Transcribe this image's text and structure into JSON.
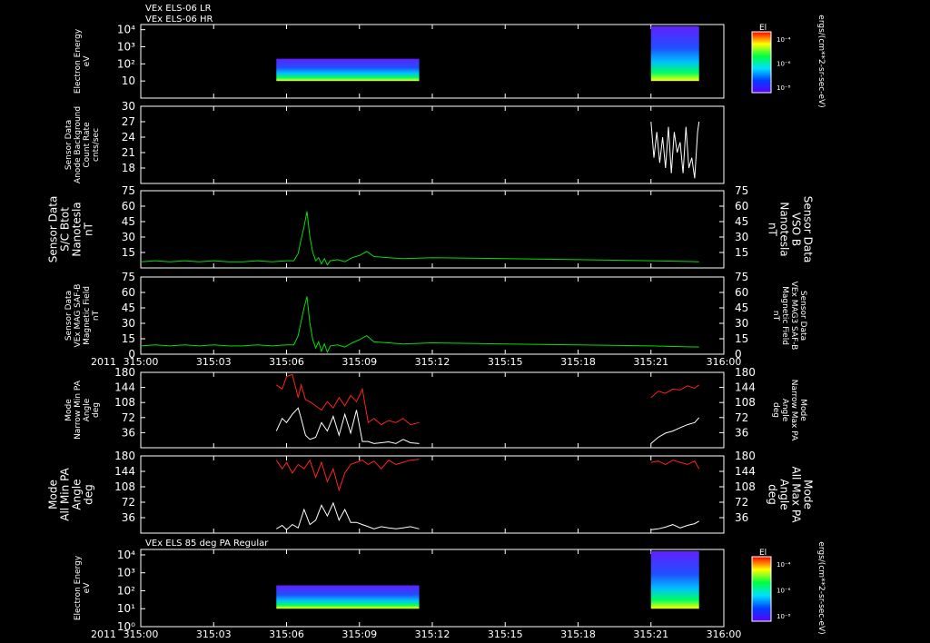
{
  "header": {
    "line1": "VEx ELS-06 LR",
    "line2": "VEx ELS-06 HR"
  },
  "year_label": "2011",
  "time_ticks": [
    "315:00",
    "315:03",
    "315:06",
    "315:09",
    "315:12",
    "315:15",
    "315:18",
    "315:21",
    "316:00"
  ],
  "colors": {
    "white": "#ffffff",
    "green": "#00e000",
    "red": "#ff2020",
    "frame": "#ffffff",
    "bg": "#000000"
  },
  "chart_data": [
    {
      "type": "heatmap",
      "id": "p1",
      "title": "VEx ELS-06 LR / VEx ELS-06 HR",
      "ylabel": [
        "Electron Energy",
        "eV"
      ],
      "log_y": true,
      "ylim": [
        1,
        20000
      ],
      "yticks": [
        "10",
        "10²",
        "10³",
        "10⁴"
      ],
      "yticks_base": [
        1,
        2,
        3,
        4
      ],
      "colorbar": {
        "title": "El",
        "ticks": [
          "10⁻⁴",
          "10⁻⁶",
          "10⁻⁸"
        ]
      },
      "colorbar_label": "ergs/(cm**2-sr-sec-eV)",
      "data_ranges": [
        [
          315.093,
          315.191
        ],
        [
          315.35,
          315.383
        ]
      ]
    },
    {
      "type": "line",
      "id": "p2",
      "ylabel": [
        "Sensor Data",
        "Anode Background",
        "Count Rate",
        "cnts/sec"
      ],
      "ylim": [
        15,
        30
      ],
      "yticks": [
        18,
        21,
        24,
        27,
        30
      ],
      "series": [
        {
          "color": "white",
          "x": [
            315.35,
            315.352,
            315.354,
            315.356,
            315.358,
            315.36,
            315.362,
            315.364,
            315.366,
            315.368,
            315.37,
            315.372,
            315.374,
            315.376,
            315.378,
            315.38,
            315.382,
            315.383
          ],
          "y": [
            27,
            20,
            25,
            19,
            24,
            18,
            26,
            17,
            25,
            21,
            23,
            17,
            26,
            18,
            20,
            16,
            25,
            27
          ]
        }
      ]
    },
    {
      "type": "line",
      "id": "p3",
      "ylabel": [
        "Sensor Data",
        "S/C Btot",
        "Nanotesla",
        "nT"
      ],
      "ylabel_right": [
        "Sensor Data",
        "VSO B",
        "Nanotesla",
        "nT"
      ],
      "ylim": [
        0,
        75
      ],
      "yticks": [
        15,
        30,
        45,
        60,
        75
      ],
      "series": [
        {
          "color": "green",
          "x": [
            315.0,
            315.01,
            315.02,
            315.03,
            315.04,
            315.05,
            315.06,
            315.07,
            315.08,
            315.09,
            315.1,
            315.105,
            315.108,
            315.11,
            315.112,
            315.114,
            315.116,
            315.118,
            315.12,
            315.122,
            315.124,
            315.126,
            315.128,
            315.13,
            315.135,
            315.14,
            315.145,
            315.15,
            315.155,
            315.16,
            315.17,
            315.18,
            315.2,
            315.25,
            315.3,
            315.35,
            315.383
          ],
          "y": [
            6,
            7,
            6,
            7,
            6,
            7,
            6,
            6,
            7,
            6,
            7,
            7,
            14,
            28,
            40,
            55,
            30,
            15,
            7,
            10,
            4,
            9,
            3,
            7,
            8,
            6,
            10,
            12,
            16,
            11,
            10,
            9,
            10,
            9,
            8,
            7,
            6
          ]
        }
      ]
    },
    {
      "type": "line",
      "id": "p4",
      "ylabel": [
        "Sensor Data",
        "VEx MAG SAF-B",
        "Magnetic Field",
        "nT"
      ],
      "ylabel_right": [
        "Sensor Data",
        "VEx MAG3 SAF-B",
        "Magnetic Field",
        "nT"
      ],
      "ylim": [
        0,
        75
      ],
      "yticks": [
        0,
        15,
        30,
        45,
        60,
        75
      ],
      "series": [
        {
          "color": "green",
          "x": [
            315.0,
            315.01,
            315.02,
            315.03,
            315.04,
            315.05,
            315.06,
            315.07,
            315.08,
            315.09,
            315.1,
            315.105,
            315.108,
            315.11,
            315.112,
            315.114,
            315.116,
            315.118,
            315.12,
            315.122,
            315.124,
            315.126,
            315.128,
            315.13,
            315.135,
            315.14,
            315.145,
            315.15,
            315.155,
            315.16,
            315.17,
            315.18,
            315.2,
            315.25,
            315.3,
            315.35,
            315.383
          ],
          "y": [
            8,
            9,
            8,
            9,
            8,
            9,
            8,
            8,
            9,
            8,
            9,
            9,
            18,
            32,
            45,
            56,
            30,
            14,
            6,
            12,
            3,
            10,
            2,
            8,
            9,
            7,
            11,
            14,
            18,
            12,
            11,
            10,
            11,
            10,
            9,
            8,
            7
          ]
        }
      ]
    },
    {
      "type": "line",
      "id": "p5",
      "ylabel": [
        "Mode",
        "Narrow Min PA",
        "Angle",
        "deg"
      ],
      "ylabel_right": [
        "Mode",
        "Narrow Max PA",
        "Angle",
        "deg"
      ],
      "ylim": [
        0,
        180
      ],
      "yticks": [
        36,
        72,
        108,
        144,
        180
      ],
      "series": [
        {
          "color": "white",
          "x": [
            315.093,
            315.097,
            315.1,
            315.104,
            315.108,
            315.11,
            315.113,
            315.116,
            315.12,
            315.124,
            315.128,
            315.132,
            315.136,
            315.14,
            315.144,
            315.148,
            315.152,
            315.156,
            315.16,
            315.165,
            315.17,
            315.175,
            315.18,
            315.185,
            315.191,
            null,
            315.35,
            315.355,
            315.36,
            315.365,
            315.37,
            315.375,
            315.38,
            315.383
          ],
          "y": [
            40,
            70,
            60,
            80,
            95,
            70,
            30,
            20,
            25,
            60,
            40,
            75,
            30,
            80,
            35,
            90,
            15,
            15,
            10,
            12,
            14,
            10,
            20,
            12,
            10,
            null,
            10,
            25,
            35,
            40,
            48,
            55,
            60,
            72
          ]
        },
        {
          "color": "red",
          "x": [
            315.093,
            315.097,
            315.1,
            315.104,
            315.108,
            315.11,
            315.113,
            315.116,
            315.12,
            315.124,
            315.128,
            315.132,
            315.136,
            315.14,
            315.144,
            315.148,
            315.152,
            315.156,
            315.16,
            315.165,
            315.17,
            315.175,
            315.18,
            315.185,
            315.191,
            null,
            315.35,
            315.355,
            315.36,
            315.365,
            315.37,
            315.375,
            315.38,
            315.383
          ],
          "y": [
            150,
            140,
            170,
            175,
            120,
            150,
            115,
            110,
            100,
            90,
            110,
            95,
            120,
            100,
            125,
            110,
            140,
            60,
            70,
            55,
            65,
            60,
            70,
            55,
            60,
            null,
            120,
            135,
            130,
            140,
            138,
            148,
            142,
            150
          ]
        }
      ]
    },
    {
      "type": "line",
      "id": "p6",
      "ylabel": [
        "Mode",
        "All Min PA",
        "Angle",
        "deg"
      ],
      "ylabel_right": [
        "Mode",
        "All Max PA",
        "Angle",
        "deg"
      ],
      "ylim": [
        0,
        180
      ],
      "yticks": [
        36,
        72,
        108,
        144,
        180
      ],
      "series": [
        {
          "color": "white",
          "x": [
            315.093,
            315.097,
            315.1,
            315.104,
            315.108,
            315.112,
            315.116,
            315.12,
            315.124,
            315.128,
            315.132,
            315.136,
            315.14,
            315.144,
            315.148,
            315.152,
            315.156,
            315.16,
            315.165,
            315.17,
            315.175,
            315.18,
            315.185,
            315.191,
            null,
            315.35,
            315.355,
            315.36,
            315.365,
            315.37,
            315.375,
            315.38,
            315.383
          ],
          "y": [
            10,
            18,
            8,
            20,
            12,
            55,
            20,
            30,
            65,
            40,
            70,
            30,
            55,
            25,
            25,
            20,
            15,
            10,
            15,
            12,
            10,
            12,
            15,
            10,
            null,
            8,
            10,
            14,
            20,
            12,
            18,
            22,
            28
          ]
        },
        {
          "color": "red",
          "x": [
            315.093,
            315.097,
            315.1,
            315.104,
            315.108,
            315.112,
            315.116,
            315.12,
            315.124,
            315.128,
            315.132,
            315.136,
            315.14,
            315.144,
            315.148,
            315.152,
            315.156,
            315.16,
            315.165,
            315.17,
            315.175,
            315.18,
            315.185,
            315.191,
            null,
            315.35,
            315.355,
            315.36,
            315.365,
            315.37,
            315.375,
            315.38,
            315.383
          ],
          "y": [
            170,
            150,
            165,
            140,
            160,
            150,
            170,
            130,
            165,
            120,
            150,
            100,
            140,
            160,
            165,
            170,
            160,
            168,
            150,
            170,
            160,
            165,
            170,
            172,
            null,
            165,
            168,
            160,
            170,
            165,
            160,
            168,
            150
          ]
        }
      ]
    },
    {
      "type": "heatmap",
      "id": "p7",
      "title": "VEx ELS 85 deg PA Regular",
      "ylabel": [
        "Electron Energy",
        "eV"
      ],
      "log_y": true,
      "ylim": [
        1,
        20000
      ],
      "yticks": [
        "10⁰",
        "10¹",
        "10²",
        "10³",
        "10⁴"
      ],
      "yticks_base": [
        0,
        1,
        2,
        3,
        4
      ],
      "colorbar": {
        "title": "El",
        "ticks": [
          "10⁻⁴",
          "10⁻⁶",
          "10⁻⁸"
        ]
      },
      "colorbar_label": "ergs/(cm**2-sr-sec-eV)",
      "data_ranges": [
        [
          315.093,
          315.191
        ],
        [
          315.35,
          315.383
        ]
      ]
    }
  ]
}
